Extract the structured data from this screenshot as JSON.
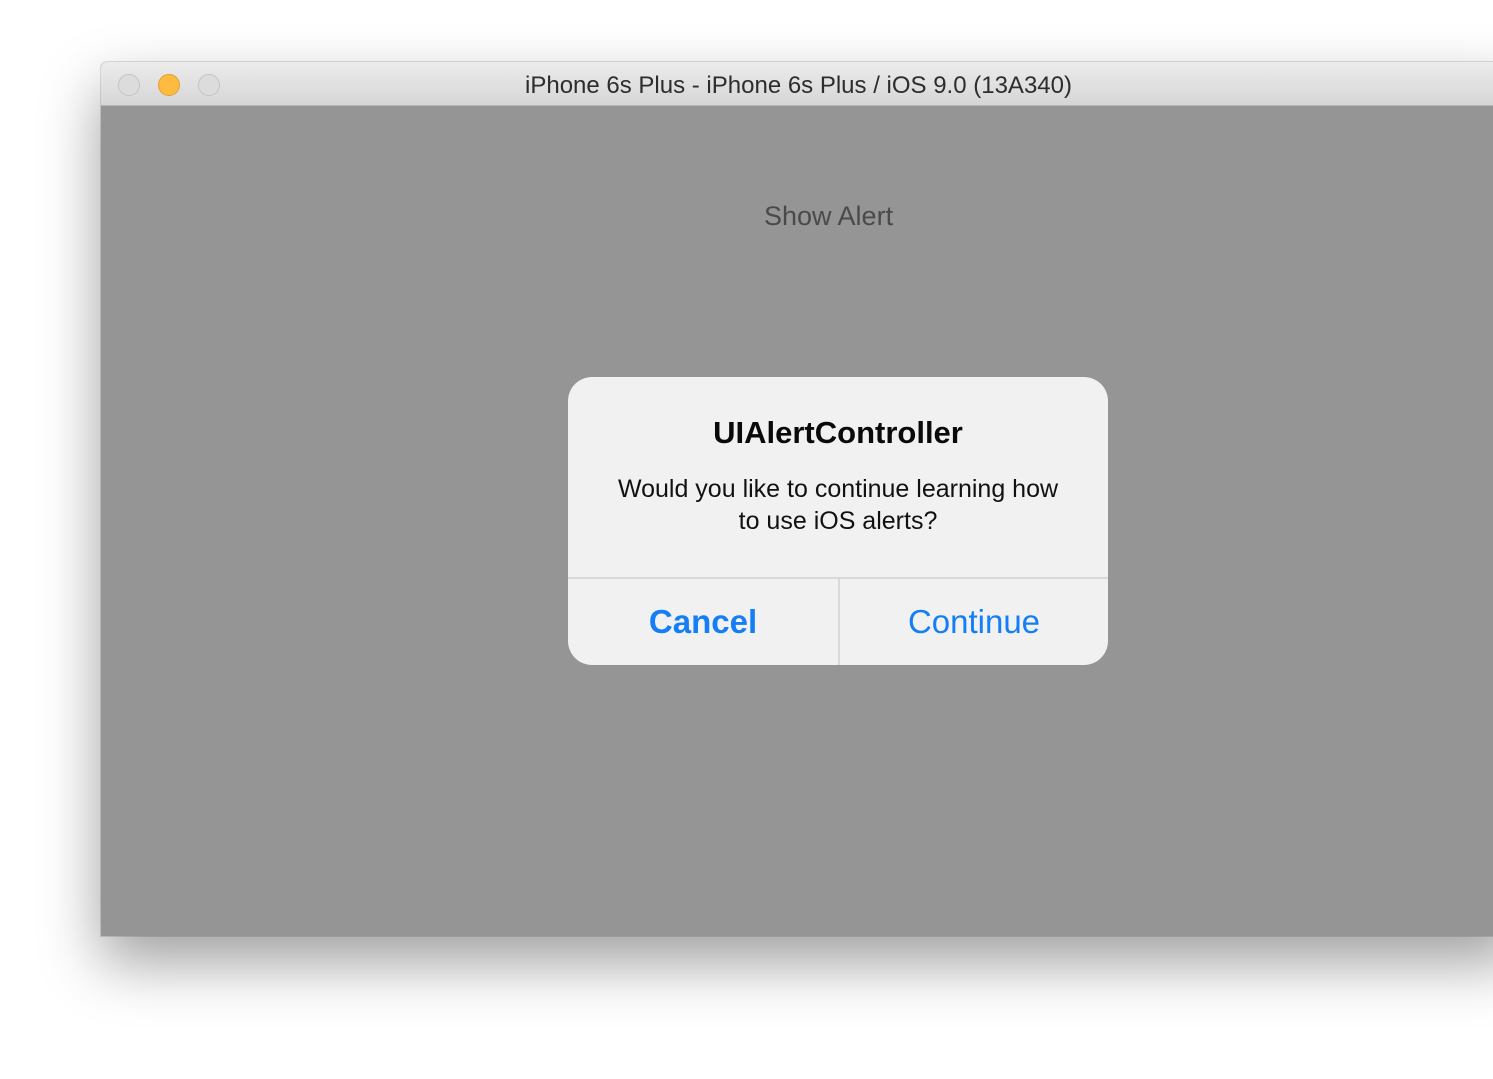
{
  "window": {
    "title": "iPhone 6s Plus - iPhone 6s Plus / iOS 9.0 (13A340)",
    "controls": [
      "close-icon",
      "minimize-icon",
      "zoom-icon"
    ]
  },
  "screen": {
    "show_alert_label": "Show Alert"
  },
  "alert": {
    "title": "UIAlertController",
    "message": "Would you like to continue learning how to use iOS alerts?",
    "cancel_label": "Cancel",
    "continue_label": "Continue"
  },
  "colors": {
    "accent": "#147ef7",
    "minimize_button": "#fdbc40",
    "screen_background": "#959595",
    "alert_background": "#f1f1f1"
  }
}
